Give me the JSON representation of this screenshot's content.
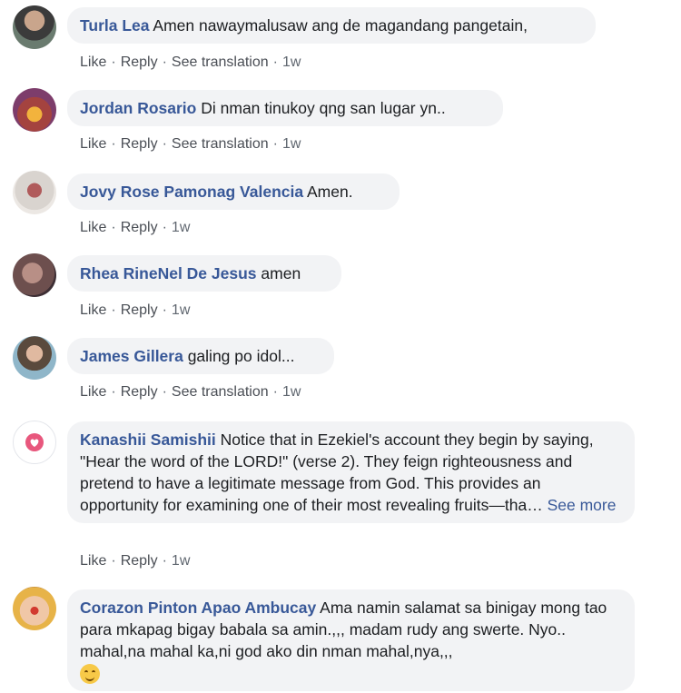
{
  "actions": {
    "like": "Like",
    "reply": "Reply",
    "see_translation": "See translation",
    "separator": "·"
  },
  "comments": [
    {
      "author": "Turla Lea",
      "text": "Amen nawaymalusaw ang de magandang pangetain,",
      "time": "1w",
      "avatar": "user-photo"
    },
    {
      "author": "Jordan Rosario",
      "text": "Di nman tinukoy qng san lugar yn..",
      "time": "1w",
      "avatar": "user-photo"
    },
    {
      "author": "Jovy Rose Pamonag Valencia",
      "text": "Amen.",
      "time": "1w",
      "avatar": "user-photo"
    },
    {
      "author": "Rhea RineNel De Jesus",
      "text": "amen",
      "time": "1w",
      "avatar": "user-photo"
    },
    {
      "author": "James Gillera",
      "text": "galing po idol...",
      "time": "1w",
      "avatar": "user-photo"
    },
    {
      "author": "Kanashii Samishii",
      "text": "Notice that in Ezekiel's account they begin by saying, \"Hear the word of the LORD!\" (verse 2). They feign righteousness and pretend to have a legitimate message from God. This provides an opportunity for examining one of their most revealing fruits—tha…",
      "see_more": "See more",
      "time": "1w",
      "avatar": "heart-icon"
    },
    {
      "author": "Corazon Pinton Apao Ambucay",
      "text": "Ama namin salamat sa binigay mong tao para mkapag bigay babala sa amin.,,, madam rudy ang swerte. Nyo.. mahal,na mahal ka,ni god ako din nman mahal,nya,,,",
      "emoji": "smiling-face-emoji",
      "avatar": "user-photo"
    }
  ],
  "colors": {
    "author": "#385898",
    "bubble": "#f2f3f5",
    "meta": "#606770"
  }
}
